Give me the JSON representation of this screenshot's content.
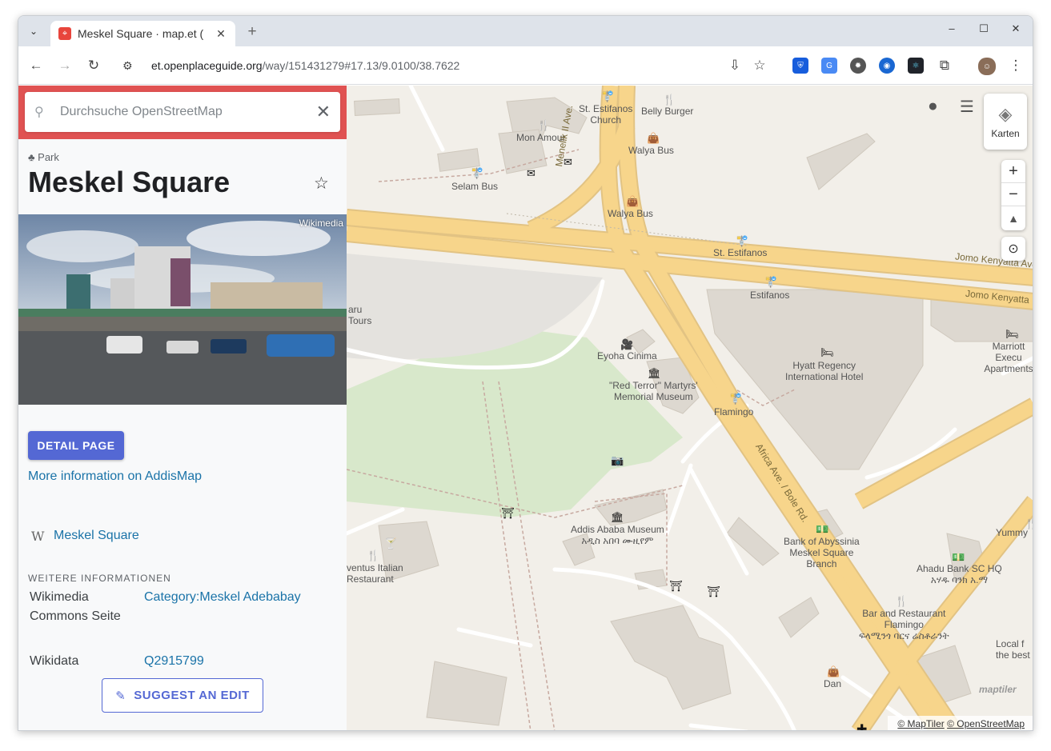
{
  "browser": {
    "tab_title": "Meskel Square · map.et (",
    "new_tab": "+",
    "url_main": "et.openplaceguide.org",
    "url_path": "/way/151431279#17.13/9.0100/38.7622",
    "controls": {
      "minimize": "–",
      "maximize": "☐",
      "close": "✕"
    }
  },
  "sidebar": {
    "search_placeholder": "Durchsuche OpenStreetMap",
    "feature_type": "Park",
    "title": "Meskel Square",
    "photo_credit": "Wikimedia",
    "detail_button": "DETAIL PAGE",
    "more_info_link": "More information on AddisMap",
    "wikipedia_symbol": "W",
    "wikipedia_link": "Meskel Square",
    "section_heading": "WEITERE INFORMATIONEN",
    "properties": [
      {
        "key": "Wikimedia Commons Seite",
        "value": "Category:Meskel Adebabay"
      },
      {
        "key": "Wikidata",
        "value": "Q2915799"
      }
    ],
    "suggest_button": "SUGGEST AN EDIT"
  },
  "map": {
    "layers_label": "Karten",
    "zoom_in": "+",
    "zoom_out": "−",
    "attribution_maptiler": "© MapTiler",
    "attribution_osm": "© OpenStreetMap",
    "logo_text": "maptiler",
    "labels": {
      "st_estifanos_church": "St. Estifanos\nChurch",
      "belly_burger": "Belly Burger",
      "mon_amour": "Mon Amour",
      "walya_bus_1": "Walya Bus",
      "walya_bus_2": "Walya Bus",
      "selam_bus": "Selam Bus",
      "menelik": "Menelik II Ave.",
      "st_estifanos": "St. Estifanos",
      "jomo_1": "Jomo Kenyatta Ave.",
      "jomo_2": "Jomo Kenyatta",
      "estifanos": "Estifanos",
      "hyatt": "Hyatt Regency\nInternational Hotel",
      "marriott": "Marriott Execu\nApartments",
      "eyoha": "Eyoha Cinima",
      "red_terror": "\"Red Terror\" Martyrs'\nMemorial Museum",
      "flamingo": "Flamingo",
      "africa_ave": "Africa Ave. / Bole Rd.",
      "aru_tours": "aru\nTours",
      "museum": "Addis Ababa Museum\nአዲስ አበባ ሙዚየም",
      "abyssinia": "Bank of Abyssinia\nMeskel Square\nBranch",
      "yummy": "Yummy",
      "ahadu": "Ahadu Bank SC HQ\nአሃዱ ባንክ አ.ማ",
      "italian": "ventus Italian\nRestaurant",
      "bar_flamingo": "Bar and Restaurant\nFlamingo\nፍላሚንጎ ባርና ሬስቶራንት",
      "local": "Local f\nthe best",
      "dan": "Dan"
    }
  },
  "colors": {
    "accent": "#5468d4",
    "search_band": "#e05252",
    "link": "#1a73a8",
    "road": "#f7d58b",
    "park": "#d8e8cb"
  }
}
